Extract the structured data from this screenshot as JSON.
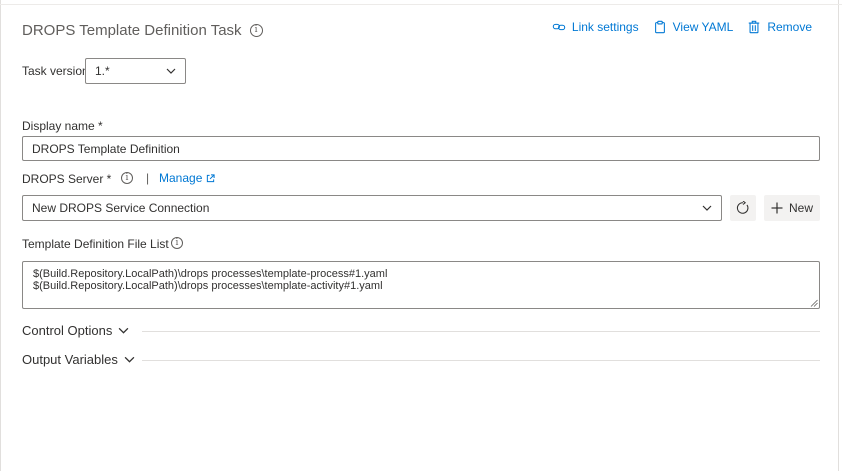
{
  "task": {
    "title": "DROPS Template Definition Task"
  },
  "header_actions": {
    "link_settings": "Link settings",
    "view_yaml": "View YAML",
    "remove": "Remove"
  },
  "task_version": {
    "label": "Task version",
    "value": "1.*"
  },
  "display_name": {
    "label": "Display name *",
    "value": "DROPS Template Definition"
  },
  "drops_server": {
    "label": "DROPS Server *",
    "separator": "|",
    "manage_label": "Manage",
    "value": "New DROPS Service Connection",
    "new_button_label": "New"
  },
  "template_file_list": {
    "label": "Template Definition File List",
    "lines": [
      "$(Build.Repository.LocalPath)\\drops processes\\template-process#1.yaml",
      "$(Build.Repository.LocalPath)\\drops processes\\template-activity#1.yaml"
    ]
  },
  "sections": {
    "control_options": "Control Options",
    "output_variables": "Output Variables"
  },
  "colors": {
    "accent": "#0078d4",
    "text": "#323130",
    "muted": "#605e5c",
    "border": "#8a8886",
    "button_bg": "#f3f2f1"
  },
  "icons": {
    "title_info": "info-icon",
    "link_settings": "link-icon",
    "view_yaml": "clipboard-icon",
    "remove": "trash-icon",
    "manage": "external-link-icon",
    "refresh": "refresh-icon",
    "new": "plus-icon",
    "dropdown": "chevron-down-icon"
  }
}
